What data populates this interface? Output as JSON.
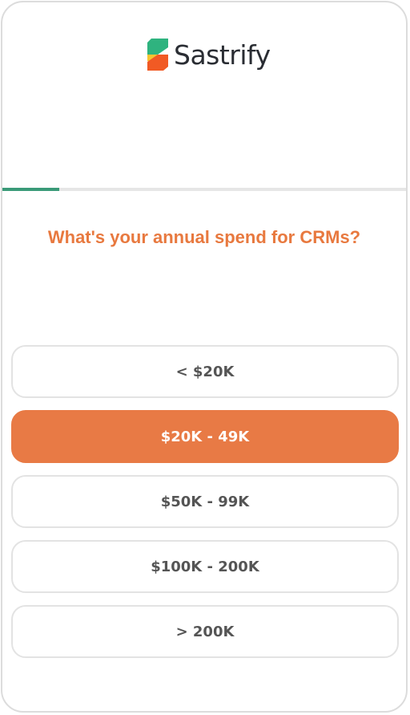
{
  "brand": {
    "name": "Sastrify",
    "colors": {
      "green": "#2fb37f",
      "orange": "#f15a24",
      "yellow": "#f7c531"
    }
  },
  "progress": {
    "fraction": 0.14,
    "color": "#3a9a78"
  },
  "question": {
    "text": "What's your annual spend for CRMs?",
    "color": "#e8793f"
  },
  "options": [
    {
      "label": "< $20K",
      "selected": false
    },
    {
      "label": "$20K - 49K",
      "selected": true
    },
    {
      "label": "$50K - 99K",
      "selected": false
    },
    {
      "label": "$100K - 200K",
      "selected": false
    },
    {
      "label": "> 200K",
      "selected": false
    }
  ],
  "accent": "#e87a45"
}
